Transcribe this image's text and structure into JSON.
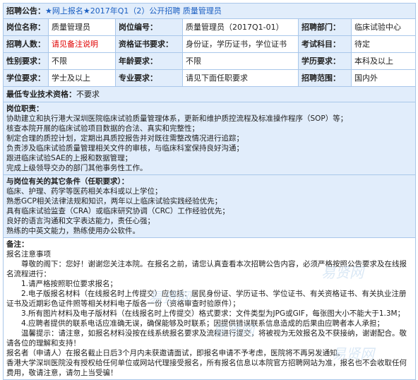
{
  "header": {
    "label": "招聘公告：",
    "title": "★网上报名★2017年Q1（2）公开招聘 质量管理员"
  },
  "rows": {
    "r1": [
      {
        "label": "岗位名称：",
        "value": "质量管理员"
      },
      {
        "label": "岗位编号：",
        "value": "质量管理员（2017Q1-01）"
      },
      {
        "label": "招聘部门：",
        "value": "临床试验中心"
      }
    ],
    "r2": [
      {
        "label": "招聘人数：",
        "value": "请见备注说明"
      },
      {
        "label": "资格证书要求：",
        "value": "身份证，学历证书，学位证书"
      },
      {
        "label": "考试科目：",
        "value": "待定"
      }
    ],
    "r3": [
      {
        "label": "性别要求：",
        "value": "不限"
      },
      {
        "label": "年龄要求：",
        "value": "不限"
      },
      {
        "label": "学历要求：",
        "value": "本科及以上"
      }
    ],
    "r4": [
      {
        "label": "学位要求：",
        "value": "学士及以上"
      },
      {
        "label": "专业要求：",
        "value": "请见下面任职要求"
      },
      {
        "label": "招聘范围：",
        "value": "国内外"
      }
    ]
  },
  "tech": {
    "label": "最低专业技术资格：",
    "value": "不要求"
  },
  "duties": {
    "title": "岗位职责：",
    "lines": [
      "协助建立和执行港大深圳医院临床试验质量管理体系，更新和维护质控流程及标准操作程序（SOP）等；",
      "核查本院开展的临床试验项目数据的合法、真实和完整性；",
      "制定合理的质控计划，定期出具质控报告并对既往需整改情况进行追踪；",
      "负责涉及临床试验质量管理相关文件的审核，与临床科室保持良好沟通；",
      "跟进临床试验SAE的上报和数据管理；",
      "完成上级领导交办的部门其他事务性工作。"
    ]
  },
  "conditions": {
    "title": "与岗位有关的其它条件（任职要求）：",
    "lines": [
      "临床、护理、药学等医药相关本科或以上学位；",
      "熟悉GCP相关法律法规和知识，两年以上临床试验实践经验优先；",
      "具有临床试验监查（CRA）或临床研究协调（CRC）工作经验优先；",
      "良好的语言沟通和文字表达能力，责任心强；",
      "熟练的中英文能力，熟练使用办公软件。"
    ]
  },
  "notes": {
    "title": "备注：",
    "lines": [
      "报名注意事项",
      "　　尊敬的阁下：您好！谢谢您关注本院。在报名之前，请您认真查看本次招聘公告内容，必须严格按照公告要求及在线报名流程进行：",
      "　　1.请严格按照职位要求报名；",
      "　　2.电子版报名材料（在线报名时上传提交）应包括：居民身份证、学历证书、学位证书、有关资格证书、有关执业注册证书及近期彩色证件照等相关材料电子版各一份（资格审查时验原件）；",
      "　　3.所有图片材料及电子版材料（在线报名时上传提交）格式要求：文件类型为JPG或GIF，每张图大小不能大于1.3M；",
      "　　4.应聘者提供的联系电话应准确无误，确保能够及时联系；因提供错误联系信息造成的后果由应聘者本人承担；",
      "　　温馨提示：请注意，如报名材料没按在线系统报名要求及流程进行提交，将被视为无效报名及不获接纳，谢谢配合。敬请各位的理解和支持！",
      "报名者（申请人）在报名截止日后3个月内未获邀请面试，即报名申请不予考虑，医院将不再另发通知。",
      "香港大学深圳医院没有授权给任何单位或网站代理接受报名，所有报名信息以本院官方招聘网站为准，报名也不会收取任何费用，敬请注意，请勿上当受骗！"
    ]
  },
  "watermarks": [
    "易贤网",
    "易贤网",
    "易贤网",
    "易贤网"
  ]
}
